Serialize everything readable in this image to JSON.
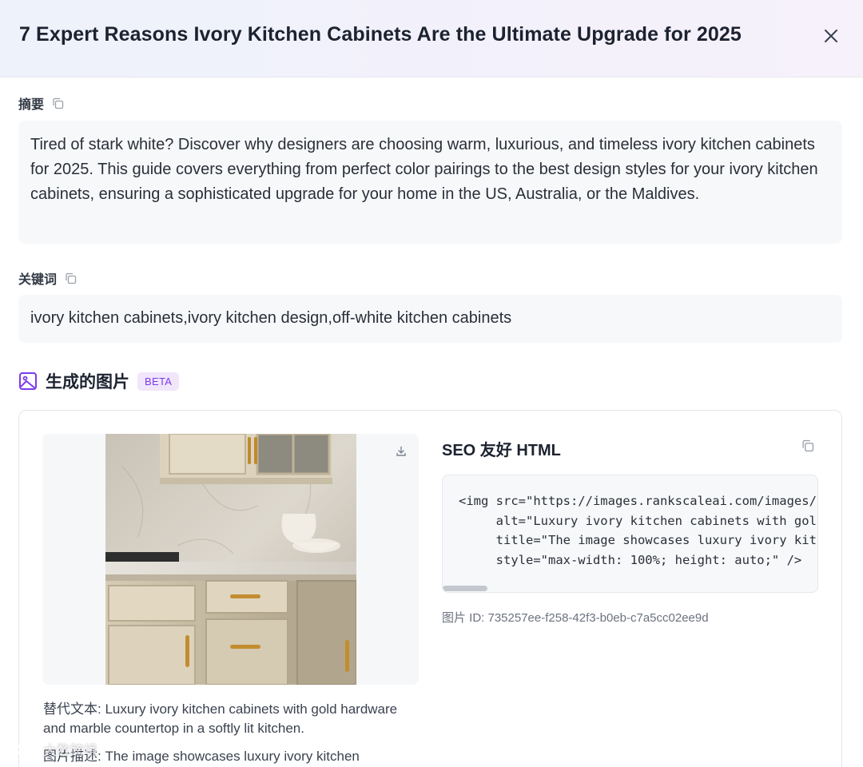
{
  "modal": {
    "title": "7 Expert Reasons Ivory Kitchen Cabinets Are the Ultimate Upgrade for 2025",
    "close_icon": "close-icon"
  },
  "summary": {
    "label": "摘要",
    "text": "Tired of stark white? Discover why designers are choosing warm, luxurious, and timeless ivory kitchen cabinets for 2025. This guide covers everything from perfect color pairings to the best design styles for your ivory kitchen cabinets, ensuring a sophisticated upgrade for your home in the US, Australia, or the Maldives."
  },
  "keywords": {
    "label": "关键词",
    "text": "ivory kitchen cabinets,ivory kitchen design,off-white kitchen cabinets"
  },
  "generated_images": {
    "title": "生成的图片",
    "badge": "BETA",
    "icon": "image-icon",
    "item": {
      "alt_caption": "替代文本: Luxury ivory kitchen cabinets with gold hardware and marble countertop in a softly lit kitchen.",
      "desc_caption": "图片描述: The image showcases luxury ivory kitchen",
      "seo_title": "SEO 友好 HTML",
      "code_lines": [
        "<img src=\"https://images.rankscaleai.com/images/",
        "     alt=\"Luxury ivory kitchen cabinets with gol",
        "     title=\"The image showcases luxury ivory kit",
        "     style=\"max-width: 100%; height: auto;\" />"
      ],
      "image_id": "图片 ID: 735257ee-f258-42f3-b0eb-c7a5cc02ee9d"
    }
  },
  "watermark": {
    "text": "大数跨境"
  },
  "colors": {
    "accent_purple": "#7c3aed",
    "badge_bg": "#f1e6fb",
    "box_bg": "#f7f8fa"
  }
}
